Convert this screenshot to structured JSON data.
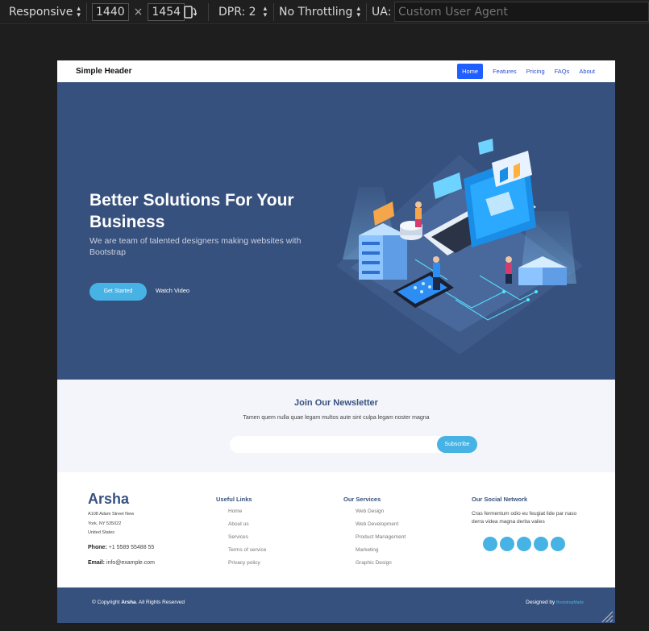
{
  "devtools": {
    "device": "Responsive",
    "width": "1440",
    "times": "×",
    "height": "1454",
    "dpr": "DPR: 2",
    "throttling": "No Throttling",
    "ua_label": "UA:",
    "ua_placeholder": "Custom User Agent"
  },
  "header": {
    "brand": "Simple Header",
    "nav": [
      "Home",
      "Features",
      "Pricing",
      "FAQs",
      "About"
    ],
    "active_nav": "Home"
  },
  "hero": {
    "title": "Better Solutions For Your Business",
    "subtitle": "We are team of talented designers making websites with Bootstrap",
    "cta": "Get Started",
    "video": "Watch Video"
  },
  "newsletter": {
    "title": "Join Our Newsletter",
    "text": "Tamen quem nulla quae legam multos aute sint culpa legam noster magna",
    "button": "Subscribe"
  },
  "footer": {
    "brand": "Arsha",
    "address": [
      "A108 Adam Street New",
      "York, NY 535022",
      "United States"
    ],
    "phone_label": "Phone:",
    "phone": "+1 5589 55488 55",
    "email_label": "Email:",
    "email": "info@example.com",
    "useful_links_title": "Useful Links",
    "useful_links": [
      "Home",
      "About us",
      "Services",
      "Terms of service",
      "Privacy policy"
    ],
    "services_title": "Our Services",
    "services": [
      "Web Design",
      "Web Development",
      "Product Management",
      "Marketing",
      "Graphic Design"
    ],
    "social_title": "Our Social Network",
    "social_text": "Cras fermentum odio eu feugiat lide par naso derra videa magna derita valies",
    "social_icons": [
      "twitter-icon",
      "facebook-icon",
      "instagram-icon",
      "skype-icon",
      "linkedin-icon"
    ]
  },
  "bottom": {
    "copyright_prefix": "© Copyright ",
    "copyright_brand": "Arsha",
    "copyright_suffix": ". All Rights Reserved",
    "designed_by": "Designed by ",
    "designer": "BootstrapMade"
  },
  "colors": {
    "primary": "#37517e",
    "accent": "#47b2e4",
    "nav_active": "#1f5eff"
  }
}
